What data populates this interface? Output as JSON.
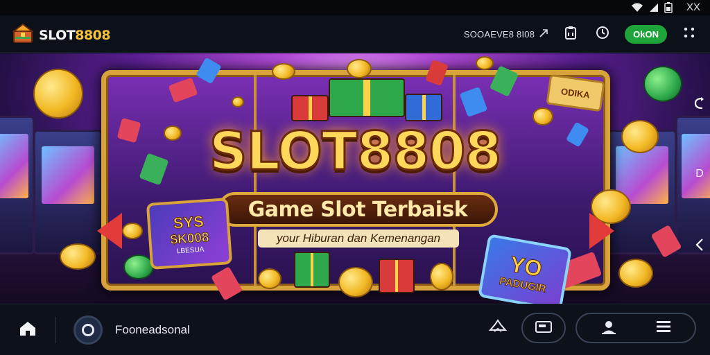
{
  "status_bar": {
    "wifi_icon": "wifi-icon",
    "signal_icon": "signal-icon",
    "battery_icon": "battery-icon",
    "extra_text": "XX"
  },
  "header": {
    "brand_prefix": "SLOT",
    "brand_suffix": "8808",
    "promo_text": "SOOAEVE8 8I08",
    "actions": {
      "clipboard_icon": "clipboard-icon",
      "clock_icon": "clock-icon",
      "toggle_label": "OkON",
      "more_icon": "grid-dots-icon"
    }
  },
  "banner": {
    "title": "SLOT8808",
    "subtitle": "Game Slot Terbaisk",
    "tagline": "your Hiburan dan Kemenangan",
    "card_left": {
      "line1": "SYS",
      "line2": "$K008",
      "line3": "LBESUA"
    },
    "card_right": {
      "line1": "YO",
      "line2": "PADUGIR"
    },
    "ticket": "ODIKA"
  },
  "side_tabs": [
    "share-icon",
    "D",
    "back-arrow-icon"
  ],
  "bottom_nav": {
    "home_icon": "home-icon",
    "profile_label": "Fooneadsonal",
    "items": [
      "hanger-icon",
      "wallet-icon",
      "user-icon",
      "menu-icon"
    ]
  },
  "colors": {
    "accent_gold": "#f6c33b",
    "accent_green": "#1ea43a",
    "banner_purple": "#5b1f93",
    "arrow_red": "#e33a3a"
  }
}
